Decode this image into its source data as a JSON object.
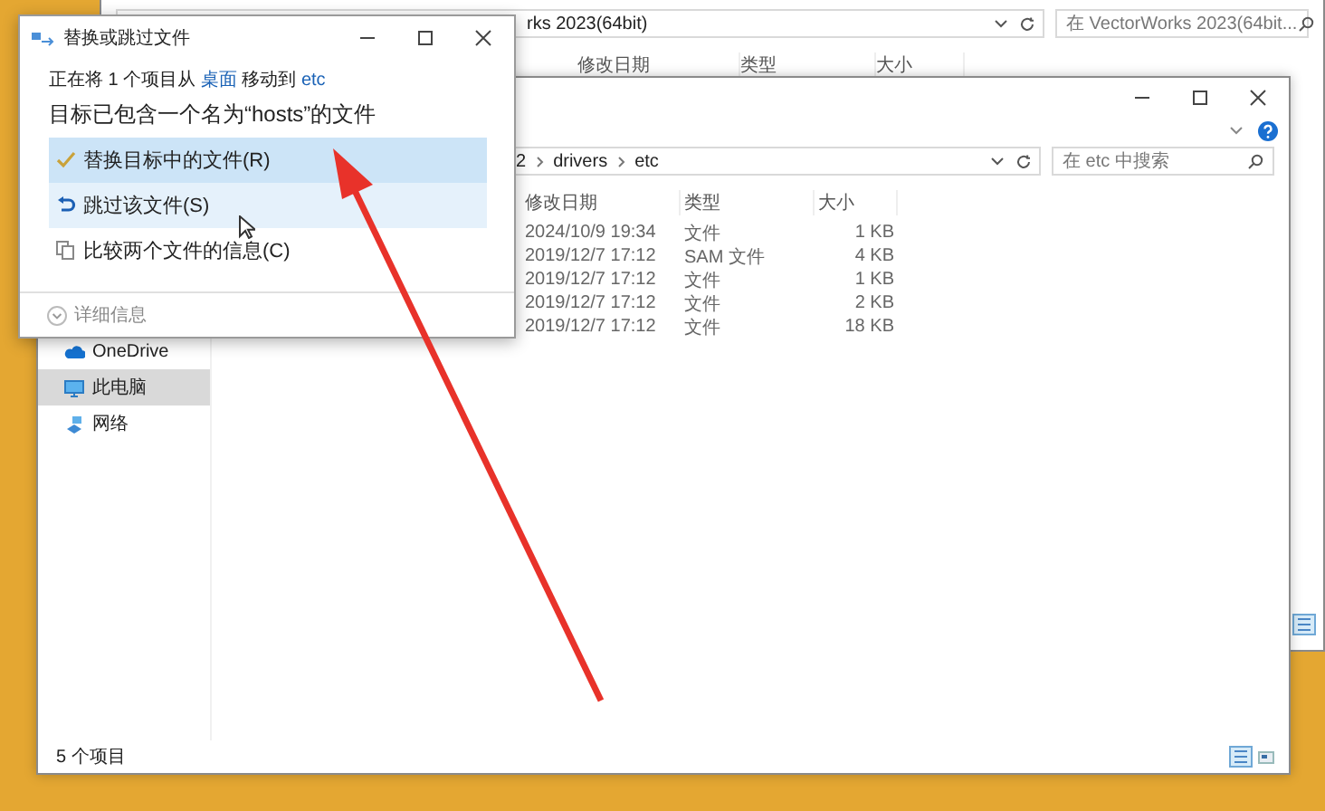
{
  "back_window": {
    "address_path": [
      "rks 2023(64bit)"
    ],
    "search": {
      "placeholder": "在 VectorWorks 2023(64bit... "
    },
    "columns": [
      "修改日期",
      "类型",
      "大小"
    ]
  },
  "explorer": {
    "address_path": [
      "2",
      "drivers",
      "etc"
    ],
    "search": {
      "placeholder": "在 etc 中搜索"
    },
    "columns": [
      "修改日期",
      "类型",
      "大小"
    ],
    "rows": [
      {
        "modified": "2024/10/9 19:34",
        "type": "文件",
        "size": "1 KB"
      },
      {
        "modified": "2019/12/7 17:12",
        "type": "SAM 文件",
        "size": "4 KB"
      },
      {
        "modified": "2019/12/7 17:12",
        "type": "文件",
        "size": "1 KB"
      },
      {
        "modified": "2019/12/7 17:12",
        "type": "文件",
        "size": "2 KB"
      },
      {
        "modified": "2019/12/7 17:12",
        "type": "文件",
        "size": "18 KB"
      }
    ],
    "sidebar": {
      "items": [
        {
          "label": "OneDrive",
          "kind": "cloud",
          "selected": false
        },
        {
          "label": "此电脑",
          "kind": "computer",
          "selected": true
        },
        {
          "label": "网络",
          "kind": "network",
          "selected": false
        }
      ]
    },
    "status_bar": "5 个项目"
  },
  "dialog": {
    "title": "替换或跳过文件",
    "source_line": {
      "before": "正在将 1 个项目从",
      "source": "桌面",
      "middle": "移动到",
      "destination": "etc"
    },
    "heading": "目标已包含一个名为“hosts”的文件",
    "options": [
      {
        "label": "替换目标中的文件(R)",
        "kind": "replace",
        "selected": true,
        "hovered": false
      },
      {
        "label": "跳过该文件(S)",
        "kind": "skip",
        "selected": false,
        "hovered": true
      },
      {
        "label": "比较两个文件的信息(C)",
        "kind": "compare",
        "selected": false,
        "hovered": false
      }
    ],
    "details": "详细信息"
  }
}
